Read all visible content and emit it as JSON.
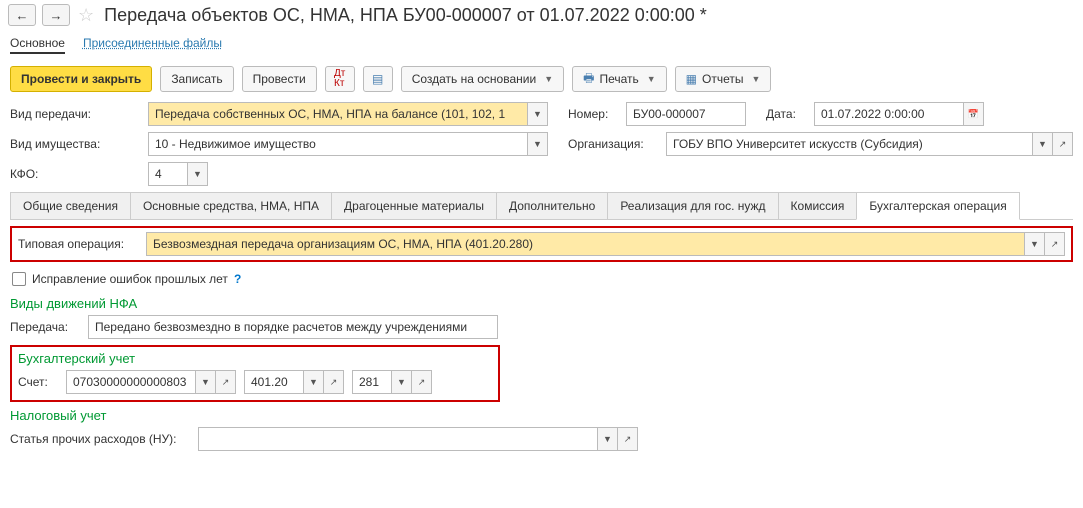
{
  "header": {
    "title": "Передача объектов ОС, НМА, НПА БУ00-000007 от 01.07.2022 0:00:00 *"
  },
  "topTabs": {
    "main": "Основное",
    "attached": "Присоединенные файлы"
  },
  "toolbar": {
    "post_close": "Провести и закрыть",
    "save": "Записать",
    "post": "Провести",
    "create_based": "Создать на основании",
    "print": "Печать",
    "reports": "Отчеты"
  },
  "form": {
    "transfer_type_label": "Вид передачи:",
    "transfer_type_value": "Передача собственных ОС, НМА, НПА на балансе (101, 102, 1",
    "number_label": "Номер:",
    "number_value": "БУ00-000007",
    "date_label": "Дата:",
    "date_value": "01.07.2022  0:00:00",
    "property_type_label": "Вид имущества:",
    "property_type_value": "10 - Недвижимое имущество",
    "org_label": "Организация:",
    "org_value": "ГОБУ ВПО Университет искусств (Субсидия)",
    "kfo_label": "КФО:",
    "kfo_value": "4"
  },
  "subTabs": {
    "t1": "Общие сведения",
    "t2": "Основные средства, НМА, НПА",
    "t3": "Драгоценные материалы",
    "t4": "Дополнительно",
    "t5": "Реализация для гос. нужд",
    "t6": "Комиссия",
    "t7": "Бухгалтерская операция"
  },
  "typical_op": {
    "label": "Типовая операция:",
    "value": "Безвозмездная передача организациям ОС, НМА, НПА (401.20.280)"
  },
  "errors_fix": "Исправление ошибок прошлых лет",
  "sections": {
    "nfa_title": "Виды движений НФА",
    "transfer_label": "Передача:",
    "transfer_value": "Передано безвозмездно в порядке расчетов между учреждениями",
    "accounting_title": "Бухгалтерский учет",
    "account_label": "Счет:",
    "account1": "07030000000000803",
    "account2": "401.20",
    "account3": "281",
    "tax_title": "Налоговый учет",
    "other_exp_label": "Статья прочих расходов (НУ):"
  }
}
